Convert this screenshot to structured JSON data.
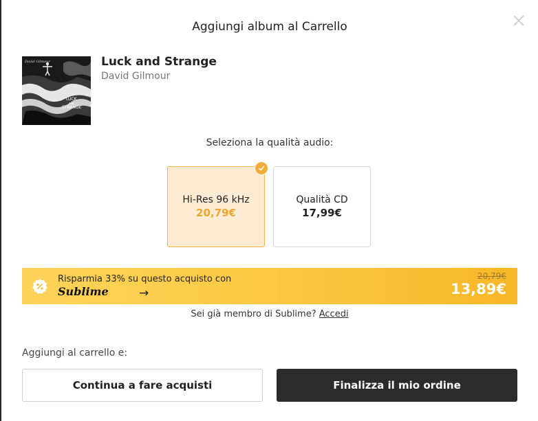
{
  "modal": {
    "title": "Aggiungi album al Carrello"
  },
  "album": {
    "title": "Luck and Strange",
    "artist": "David Gilmour",
    "cover_text_artist": "David Gilmour",
    "cover_text_luck": "LUCK",
    "cover_text_and": "and",
    "cover_text_strange": "STRANGE"
  },
  "quality": {
    "prompt": "Seleziona la qualità audio:",
    "options": [
      {
        "name": "Hi-Res 96 kHz",
        "price": "20,79€",
        "selected": true
      },
      {
        "name": "Qualità CD",
        "price": "17,99€",
        "selected": false
      }
    ]
  },
  "promo": {
    "text": "Risparmia 33% su questo acquisto con",
    "brand": "Sublime",
    "arrow": "→",
    "old_price": "20,79€",
    "new_price": "13,89€",
    "icon": "percent-badge-icon"
  },
  "member": {
    "question": "Sei già membro di Sublime?",
    "login_link": "Accedi"
  },
  "cart": {
    "label": "Aggiungi al carrello e:",
    "continue_button": "Continua a fare acquisti",
    "checkout_button": "Finalizza il mio ordine"
  },
  "colors": {
    "accent": "#f2ac38",
    "selected_bg": "#fdecd3",
    "banner_start": "#fdd35a",
    "banner_end": "#f7b728",
    "primary_button": "#2b2b2b"
  }
}
